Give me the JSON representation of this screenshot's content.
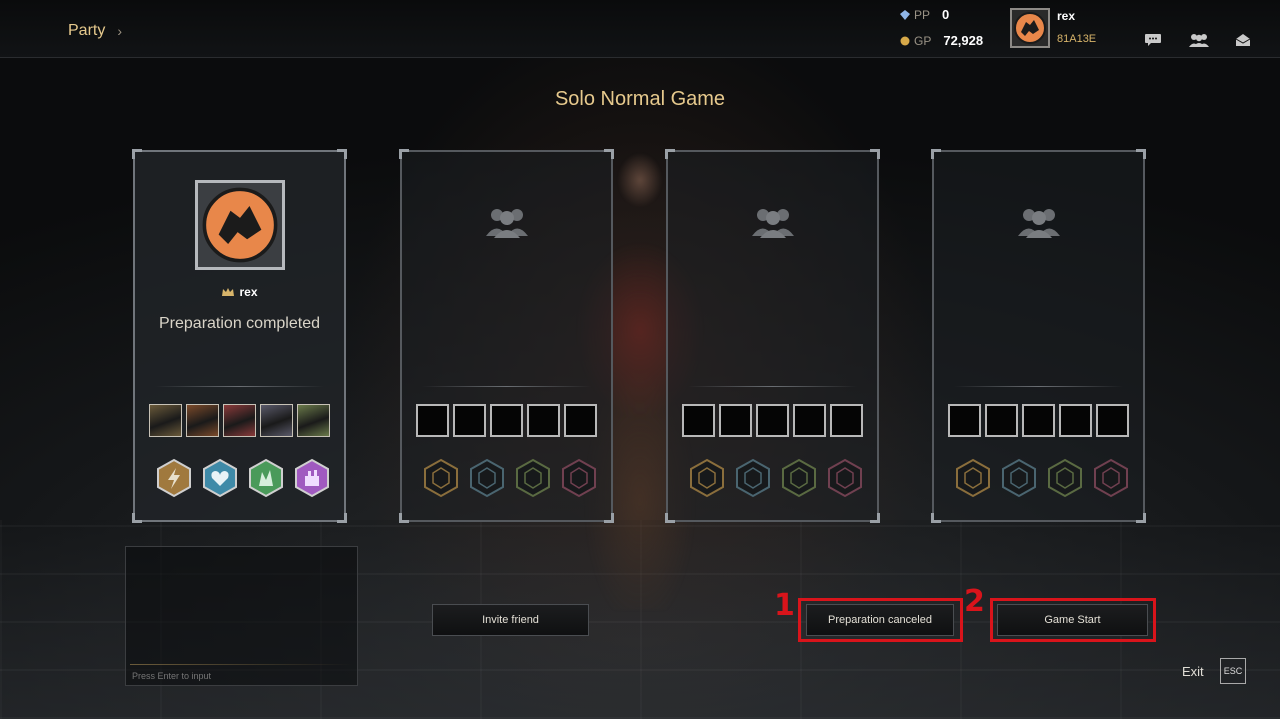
{
  "header": {
    "breadcrumb": "Party",
    "pp_label": "PP",
    "pp_value": "0",
    "gp_label": "GP",
    "gp_value": "72,928",
    "user_name": "rex",
    "user_code": "81A13E",
    "icons": [
      "chat-icon",
      "friends-icon",
      "mail-icon"
    ]
  },
  "main": {
    "title": "Solo Normal Game"
  },
  "party": {
    "leader": {
      "name": "rex",
      "status": "Preparation completed",
      "champion_colors": [
        "#6a5a3a",
        "#7b4a2a",
        "#8a3a3a",
        "#5a5a6a",
        "#6a7a4a"
      ],
      "skill_colors": [
        "#a0793e",
        "#3f8aa8",
        "#4a9a5a",
        "#a05ac0"
      ]
    },
    "empty_slots": 3
  },
  "chat": {
    "placeholder": "Press Enter to input"
  },
  "buttons": {
    "invite": "Invite friend",
    "cancel": "Preparation canceled",
    "start": "Game Start"
  },
  "annotations": {
    "marker_1": "1",
    "marker_2": "2"
  },
  "footer": {
    "exit_label": "Exit",
    "esc_label": "ESC"
  },
  "colors": {
    "accent_gold": "#e6c98d",
    "highlight_red": "#d9141b"
  }
}
